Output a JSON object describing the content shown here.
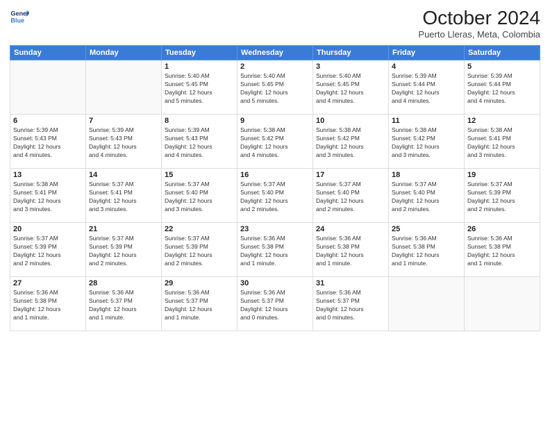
{
  "logo": {
    "line1": "General",
    "line2": "Blue"
  },
  "header": {
    "month": "October 2024",
    "location": "Puerto Lleras, Meta, Colombia"
  },
  "weekdays": [
    "Sunday",
    "Monday",
    "Tuesday",
    "Wednesday",
    "Thursday",
    "Friday",
    "Saturday"
  ],
  "weeks": [
    [
      {
        "day": "",
        "info": ""
      },
      {
        "day": "",
        "info": ""
      },
      {
        "day": "1",
        "info": "Sunrise: 5:40 AM\nSunset: 5:45 PM\nDaylight: 12 hours\nand 5 minutes."
      },
      {
        "day": "2",
        "info": "Sunrise: 5:40 AM\nSunset: 5:45 PM\nDaylight: 12 hours\nand 5 minutes."
      },
      {
        "day": "3",
        "info": "Sunrise: 5:40 AM\nSunset: 5:45 PM\nDaylight: 12 hours\nand 4 minutes."
      },
      {
        "day": "4",
        "info": "Sunrise: 5:39 AM\nSunset: 5:44 PM\nDaylight: 12 hours\nand 4 minutes."
      },
      {
        "day": "5",
        "info": "Sunrise: 5:39 AM\nSunset: 5:44 PM\nDaylight: 12 hours\nand 4 minutes."
      }
    ],
    [
      {
        "day": "6",
        "info": "Sunrise: 5:39 AM\nSunset: 5:43 PM\nDaylight: 12 hours\nand 4 minutes."
      },
      {
        "day": "7",
        "info": "Sunrise: 5:39 AM\nSunset: 5:43 PM\nDaylight: 12 hours\nand 4 minutes."
      },
      {
        "day": "8",
        "info": "Sunrise: 5:39 AM\nSunset: 5:43 PM\nDaylight: 12 hours\nand 4 minutes."
      },
      {
        "day": "9",
        "info": "Sunrise: 5:38 AM\nSunset: 5:42 PM\nDaylight: 12 hours\nand 4 minutes."
      },
      {
        "day": "10",
        "info": "Sunrise: 5:38 AM\nSunset: 5:42 PM\nDaylight: 12 hours\nand 3 minutes."
      },
      {
        "day": "11",
        "info": "Sunrise: 5:38 AM\nSunset: 5:42 PM\nDaylight: 12 hours\nand 3 minutes."
      },
      {
        "day": "12",
        "info": "Sunrise: 5:38 AM\nSunset: 5:41 PM\nDaylight: 12 hours\nand 3 minutes."
      }
    ],
    [
      {
        "day": "13",
        "info": "Sunrise: 5:38 AM\nSunset: 5:41 PM\nDaylight: 12 hours\nand 3 minutes."
      },
      {
        "day": "14",
        "info": "Sunrise: 5:37 AM\nSunset: 5:41 PM\nDaylight: 12 hours\nand 3 minutes."
      },
      {
        "day": "15",
        "info": "Sunrise: 5:37 AM\nSunset: 5:40 PM\nDaylight: 12 hours\nand 3 minutes."
      },
      {
        "day": "16",
        "info": "Sunrise: 5:37 AM\nSunset: 5:40 PM\nDaylight: 12 hours\nand 2 minutes."
      },
      {
        "day": "17",
        "info": "Sunrise: 5:37 AM\nSunset: 5:40 PM\nDaylight: 12 hours\nand 2 minutes."
      },
      {
        "day": "18",
        "info": "Sunrise: 5:37 AM\nSunset: 5:40 PM\nDaylight: 12 hours\nand 2 minutes."
      },
      {
        "day": "19",
        "info": "Sunrise: 5:37 AM\nSunset: 5:39 PM\nDaylight: 12 hours\nand 2 minutes."
      }
    ],
    [
      {
        "day": "20",
        "info": "Sunrise: 5:37 AM\nSunset: 5:39 PM\nDaylight: 12 hours\nand 2 minutes."
      },
      {
        "day": "21",
        "info": "Sunrise: 5:37 AM\nSunset: 5:39 PM\nDaylight: 12 hours\nand 2 minutes."
      },
      {
        "day": "22",
        "info": "Sunrise: 5:37 AM\nSunset: 5:39 PM\nDaylight: 12 hours\nand 2 minutes."
      },
      {
        "day": "23",
        "info": "Sunrise: 5:36 AM\nSunset: 5:38 PM\nDaylight: 12 hours\nand 1 minute."
      },
      {
        "day": "24",
        "info": "Sunrise: 5:36 AM\nSunset: 5:38 PM\nDaylight: 12 hours\nand 1 minute."
      },
      {
        "day": "25",
        "info": "Sunrise: 5:36 AM\nSunset: 5:38 PM\nDaylight: 12 hours\nand 1 minute."
      },
      {
        "day": "26",
        "info": "Sunrise: 5:36 AM\nSunset: 5:38 PM\nDaylight: 12 hours\nand 1 minute."
      }
    ],
    [
      {
        "day": "27",
        "info": "Sunrise: 5:36 AM\nSunset: 5:38 PM\nDaylight: 12 hours\nand 1 minute."
      },
      {
        "day": "28",
        "info": "Sunrise: 5:36 AM\nSunset: 5:37 PM\nDaylight: 12 hours\nand 1 minute."
      },
      {
        "day": "29",
        "info": "Sunrise: 5:36 AM\nSunset: 5:37 PM\nDaylight: 12 hours\nand 1 minute."
      },
      {
        "day": "30",
        "info": "Sunrise: 5:36 AM\nSunset: 5:37 PM\nDaylight: 12 hours\nand 0 minutes."
      },
      {
        "day": "31",
        "info": "Sunrise: 5:36 AM\nSunset: 5:37 PM\nDaylight: 12 hours\nand 0 minutes."
      },
      {
        "day": "",
        "info": ""
      },
      {
        "day": "",
        "info": ""
      }
    ]
  ]
}
